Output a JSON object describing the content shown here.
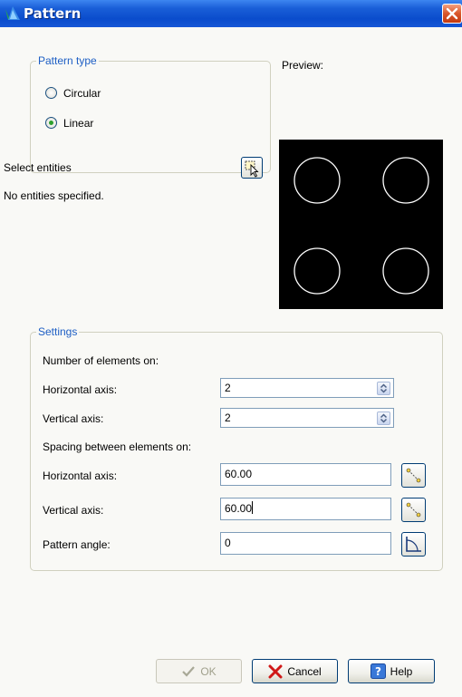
{
  "window": {
    "title": "Pattern"
  },
  "pattern_type": {
    "legend": "Pattern type",
    "options": [
      {
        "label": "Circular",
        "selected": false
      },
      {
        "label": "Linear",
        "selected": true
      }
    ]
  },
  "preview": {
    "label": "Preview:"
  },
  "selection": {
    "label": "Select entities",
    "status": "No entities specified."
  },
  "settings": {
    "legend": "Settings",
    "number_heading": "Number of elements on:",
    "horizontal_count_label": "Horizontal axis:",
    "horizontal_count_value": "2",
    "vertical_count_label": "Vertical axis:",
    "vertical_count_value": "2",
    "spacing_heading": "Spacing between elements on:",
    "horizontal_spacing_label": "Horizontal axis:",
    "horizontal_spacing_value": "60.00",
    "vertical_spacing_label": "Vertical axis:",
    "vertical_spacing_value": "60.00",
    "angle_label": "Pattern angle:",
    "angle_value": "0"
  },
  "buttons": {
    "ok": "OK",
    "cancel": "Cancel",
    "help": "Help"
  },
  "colors": {
    "title_bar": "#0a4ccc",
    "accent_text": "#1d5ec4",
    "radio_selected": "#2ea02e"
  }
}
